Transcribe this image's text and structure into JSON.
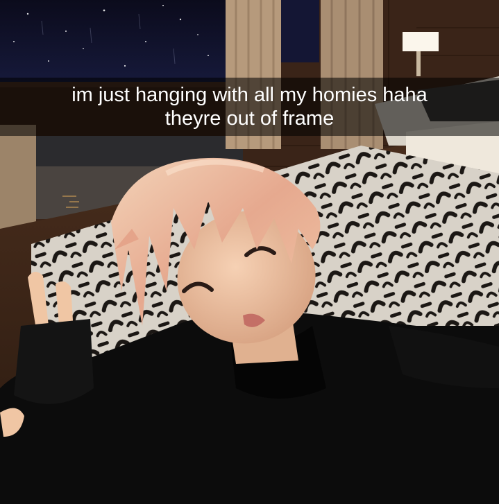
{
  "snap_caption": {
    "line1": "im just hanging with all my homies haha",
    "line2": "theyre out of frame"
  },
  "colors": {
    "caption_bg": "#000000",
    "caption_text": "#ffffff",
    "night_sky": "#0d1022",
    "wood_wall": "#3a2418",
    "rug_light": "#d9d4cc",
    "rug_dark": "#1b1714",
    "hair": "#e8b89a",
    "skin": "#f2c7a6",
    "hoodie": "#0c0c0c"
  },
  "icons": [
    "wall-lamp-icon"
  ]
}
